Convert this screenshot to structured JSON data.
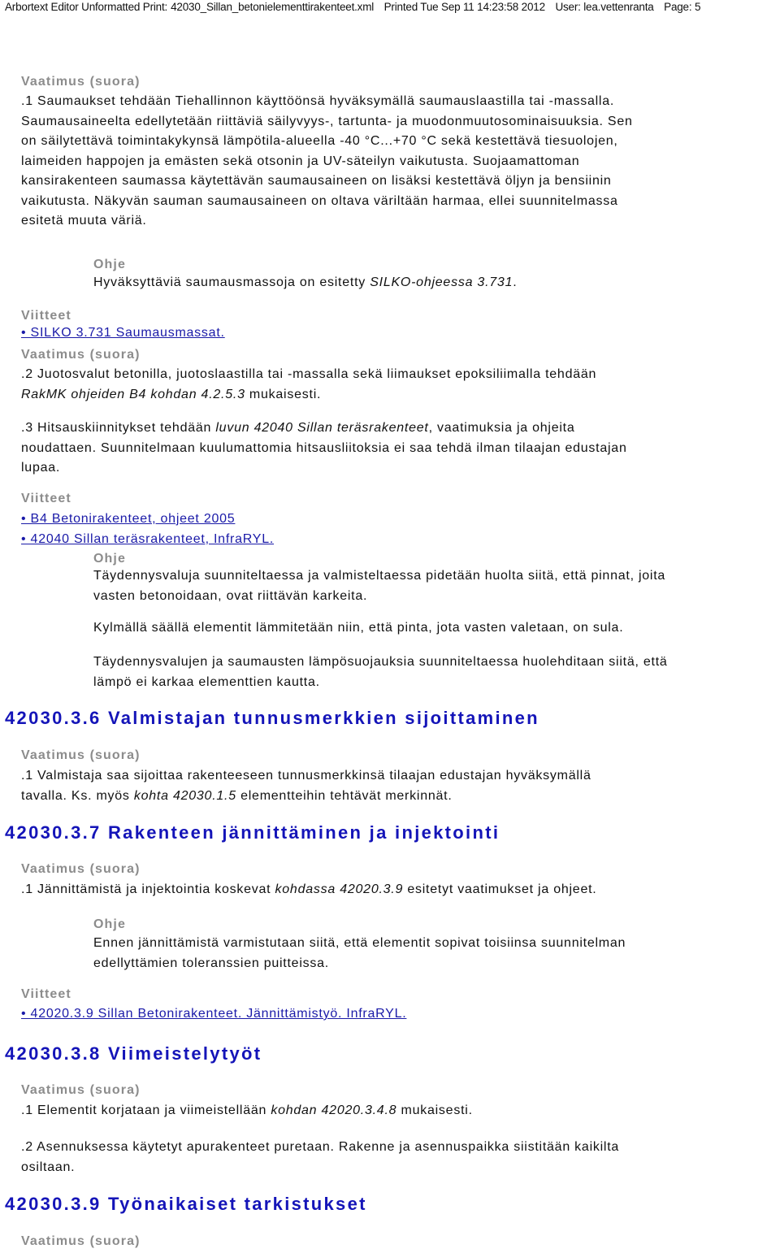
{
  "header": {
    "app": "Arbortext Editor Unformatted Print:",
    "file": "42030_Sillan_betonielementtirakenteet.xml",
    "printed": "Printed Tue Sep 11 14:23:58 2012",
    "user": "User: lea.vettenranta",
    "page": "Page: 5"
  },
  "labels": {
    "requirement": "Vaatimus (suora)",
    "guidance": "Ohje",
    "references": "Viitteet"
  },
  "block1": {
    "lines": [
      ".1 Saumaukset tehdään Tiehallinnon käyttöönsä hyväksymällä saumauslaastilla tai -massalla.",
      "Saumausaineelta edellytetään riittäviä säilyvyys-, tartunta- ja muodonmuutosominaisuuksia. Sen",
      "on säilytettävä toimintakykynsä lämpötila-alueella -40 °C...+70 °C sekä kestettävä tiesuolojen,",
      "laimeiden happojen ja emästen sekä otsonin ja UV-säteilyn vaikutusta. Suojaamattoman",
      "kansirakenteen saumassa käytettävän saumausaineen on lisäksi kestettävä öljyn ja bensiinin",
      "vaikutusta. Näkyvän sauman saumausaineen on oltava väriltään harmaa, ellei suunnitelmassa",
      "esitetä muuta väriä."
    ],
    "guidance_pre": "Hyväksyttäviä saumausmassoja on esitetty ",
    "guidance_em": "SILKO-ohjeessa 3.731",
    "guidance_post": ".",
    "reference": "• SILKO 3.731 Saumausmassat. "
  },
  "block2": {
    "line1": ".2 Juotosvalut betonilla, juotoslaastilla tai -massalla sekä liimaukset epoksiliimalla tehdään",
    "line2_em": "RakMK ohjeiden B4 kohdan 4.2.5.3",
    "line2_post": " mukaisesti."
  },
  "block3": {
    "line1_pre": ".3 Hitsauskiinnitykset tehdään ",
    "line1_em": "luvun 42040 Sillan teräsrakenteet",
    "line1_post": ", vaatimuksia ja ohjeita",
    "line2": "noudattaen. Suunnitelmaan kuulumattomia hitsausliitoksia ei saa tehdä ilman tilaajan edustajan",
    "line3": "lupaa.",
    "references": [
      "• B4 Betonirakenteet, ohjeet 2005",
      "• 42040 Sillan teräsrakenteet, InfraRYL."
    ],
    "guidance": [
      "Täydennysvaluja suunniteltaessa ja valmisteltaessa pidetään huolta siitä, että pinnat, joita",
      "vasten betonoidaan, ovat riittävän karkeita.",
      "Kylmällä säällä elementit lämmitetään niin, että pinta, jota vasten valetaan, on sula.",
      "Täydennysvalujen ja saumausten lämpösuojauksia suunniteltaessa huolehditaan siitä, että",
      "lämpö ei karkaa elementtien kautta."
    ]
  },
  "section36": {
    "title": "42030.3.6 Valmistajan tunnusmerkkien sijoittaminen",
    "line1": ".1 Valmistaja saa sijoittaa rakenteeseen tunnusmerkkinsä tilaajan edustajan hyväksymällä",
    "line2_pre": "tavalla. Ks. myös ",
    "line2_em": "kohta 42030.1.5",
    "line2_post": " elementteihin tehtävät merkinnät."
  },
  "section37": {
    "title": "42030.3.7 Rakenteen jännittäminen ja injektointi",
    "line1_pre": ".1 Jännittämistä ja injektointia koskevat ",
    "line1_em": "kohdassa 42020.3.9",
    "line1_post": " esitetyt vaatimukset ja ohjeet.",
    "guidance": [
      "Ennen jännittämistä varmistutaan siitä, että elementit sopivat toisiinsa suunnitelman",
      "edellyttämien toleranssien puitteissa."
    ],
    "reference": "• 42020.3.9 Sillan Betonirakenteet. Jännittämistyö. InfraRYL."
  },
  "section38": {
    "title": "42030.3.8 Viimeistelytyöt",
    "line1_pre": ".1 Elementit korjataan ja viimeistellään ",
    "line1_em": "kohdan 42020.3.4.8",
    "line1_post": " mukaisesti.",
    "line2": ".2 Asennuksessa käytetyt apurakenteet puretaan. Rakenne ja asennuspaikka siistitään kaikilta",
    "line3": "osiltaan."
  },
  "section39": {
    "title": "42030.3.9 Työnaikaiset tarkistukset"
  }
}
